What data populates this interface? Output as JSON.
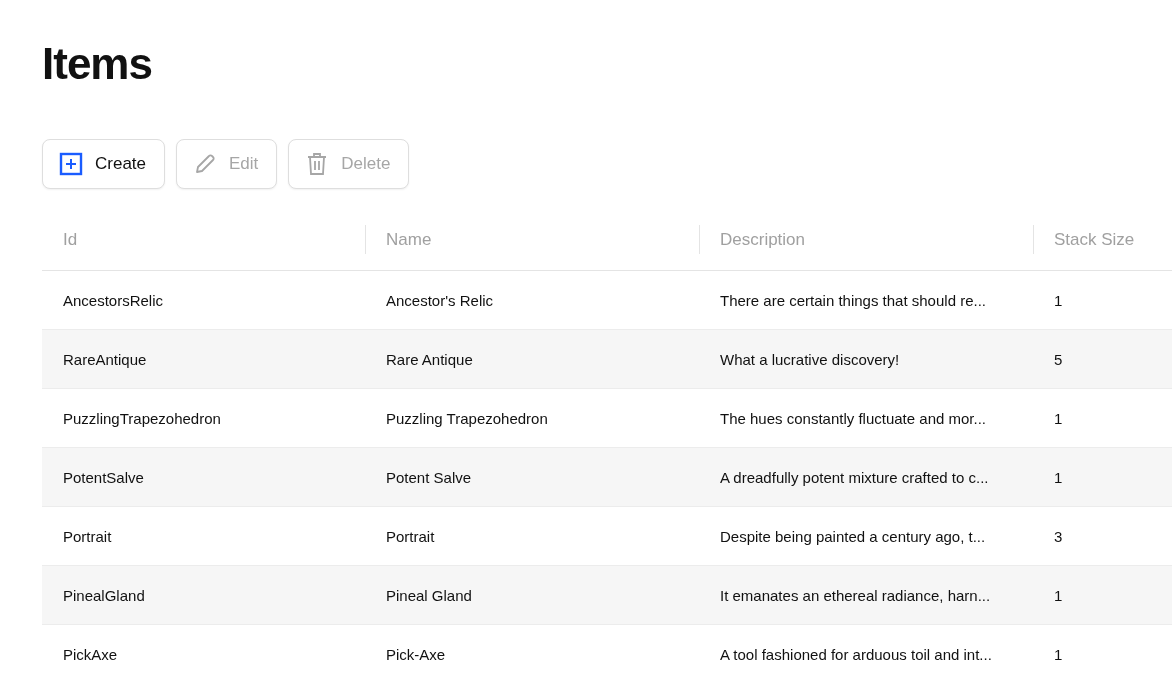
{
  "page": {
    "title": "Items"
  },
  "toolbar": [
    {
      "kind": "create",
      "label": "Create",
      "disabled": false
    },
    {
      "kind": "edit",
      "label": "Edit",
      "disabled": true
    },
    {
      "kind": "delete",
      "label": "Delete",
      "disabled": true
    }
  ],
  "table": {
    "columns": [
      "Id",
      "Name",
      "Description",
      "Stack Size"
    ],
    "rows": [
      [
        "AncestorsRelic",
        "Ancestor's Relic",
        "There are certain things that should re...",
        "1"
      ],
      [
        "RareAntique",
        "Rare Antique",
        "What a lucrative discovery!",
        "5"
      ],
      [
        "PuzzlingTrapezohedron",
        "Puzzling Trapezohedron",
        "The hues constantly fluctuate and mor...",
        "1"
      ],
      [
        "PotentSalve",
        "Potent Salve",
        "A dreadfully potent mixture crafted to c...",
        "1"
      ],
      [
        "Portrait",
        "Portrait",
        "Despite being painted a century ago, t...",
        "3"
      ],
      [
        "PinealGland",
        "Pineal Gland",
        "It emanates an ethereal radiance, harn...",
        "1"
      ],
      [
        "PickAxe",
        "Pick-Axe",
        "A tool fashioned for arduous toil and int...",
        "1"
      ]
    ]
  }
}
